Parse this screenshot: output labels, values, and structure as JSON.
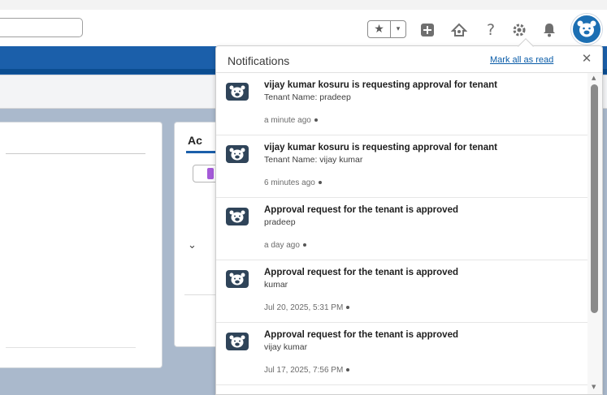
{
  "header": {
    "favorites_star": "★",
    "favorites_dropdown": "▾",
    "help_label": "?",
    "icons": [
      "favorites-star-icon",
      "dropdown-icon",
      "global-actions-icon",
      "trailhead-icon",
      "help-icon",
      "setup-gear-icon",
      "notifications-bell-icon",
      "user-avatar-icon"
    ]
  },
  "background": {
    "card_title_partial": "Ac",
    "chevron": "⌄"
  },
  "notifications": {
    "title": "Notifications",
    "mark_all_read": "Mark all as read",
    "close": "✕",
    "items": [
      {
        "title": "vijay kumar kosuru is requesting approval for tenant",
        "subtitle": "Tenant Name: pradeep",
        "time": "a minute ago"
      },
      {
        "title": "vijay kumar kosuru is requesting approval for tenant",
        "subtitle": "Tenant Name: vijay kumar",
        "time": "6 minutes ago"
      },
      {
        "title": "Approval request for the tenant is approved",
        "subtitle": "pradeep",
        "time": "a day ago"
      },
      {
        "title": "Approval request for the tenant is approved",
        "subtitle": "kumar",
        "time": "Jul 20, 2025, 5:31 PM"
      },
      {
        "title": "Approval request for the tenant is approved",
        "subtitle": "vijay kumar",
        "time": "Jul 17, 2025, 7:56 PM"
      }
    ],
    "scroll_up": "▲",
    "scroll_down": "▼"
  },
  "colors": {
    "brand_blue": "#1b5faa",
    "link_blue": "#0a5ca8",
    "avatar_navy": "#2f4459"
  }
}
